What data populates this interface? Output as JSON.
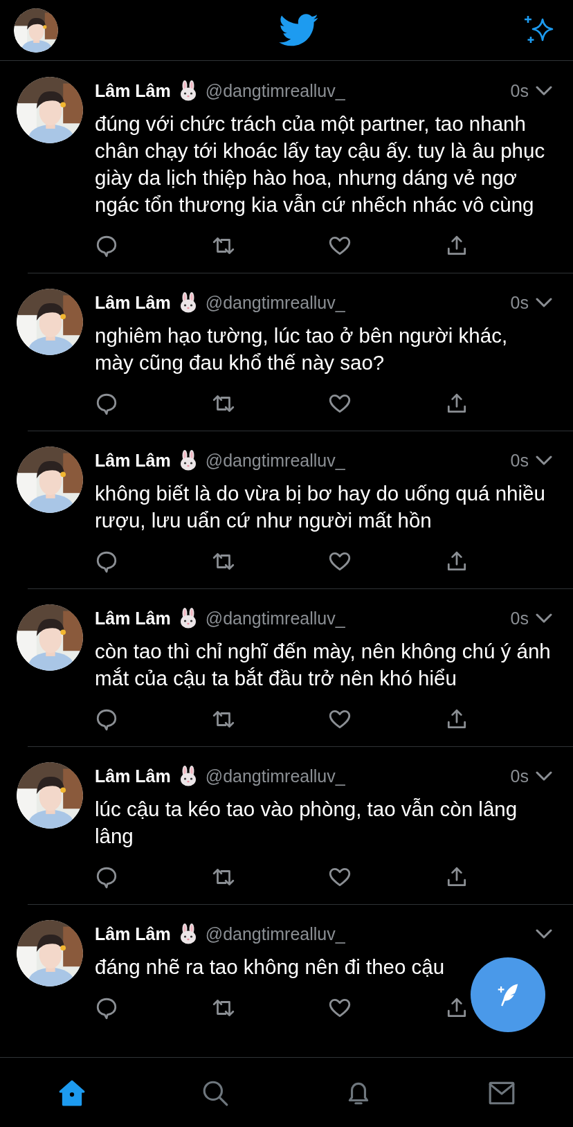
{
  "header": {
    "kind": "home"
  },
  "tweets": [
    {
      "name": "Lâm Lâm",
      "handle": "@dangtimrealluv_",
      "time": "0s",
      "text": "đúng với chức trách của một partner, tao nhanh chân chạy tới khoác lấy tay cậu ấy. tuy là âu phục giày da lịch thiệp hào hoa, nhưng dáng vẻ ngơ ngác tổn thương kia vẫn cứ nhếch nhác vô cùng"
    },
    {
      "name": "Lâm Lâm",
      "handle": "@dangtimrealluv_",
      "time": "0s",
      "text": "nghiêm hạo tường, lúc tao ở bên người khác, mày cũng đau khổ thế này sao?"
    },
    {
      "name": "Lâm Lâm",
      "handle": "@dangtimrealluv_",
      "time": "0s",
      "text": "không biết là do vừa bị bơ hay do uống quá nhiều rượu, lưu uẩn cứ như người mất hồn"
    },
    {
      "name": "Lâm Lâm",
      "handle": "@dangtimrealluv_",
      "time": "0s",
      "text": "còn tao thì chỉ nghĩ đến mày, nên không chú ý ánh mắt của cậu ta bắt đầu trở nên khó hiểu"
    },
    {
      "name": "Lâm Lâm",
      "handle": "@dangtimrealluv_",
      "time": "0s",
      "text": "lúc cậu ta kéo tao vào phòng, tao vẫn còn lâng lâng"
    },
    {
      "name": "Lâm Lâm",
      "handle": "@dangtimrealluv_",
      "text": "đáng nhẽ ra tao không nên đi theo cậu"
    }
  ],
  "tabs": [
    {
      "kind": "home",
      "selected": true
    },
    {
      "kind": "search",
      "selected": false
    },
    {
      "kind": "notifications",
      "selected": false
    },
    {
      "kind": "messages",
      "selected": false
    }
  ]
}
